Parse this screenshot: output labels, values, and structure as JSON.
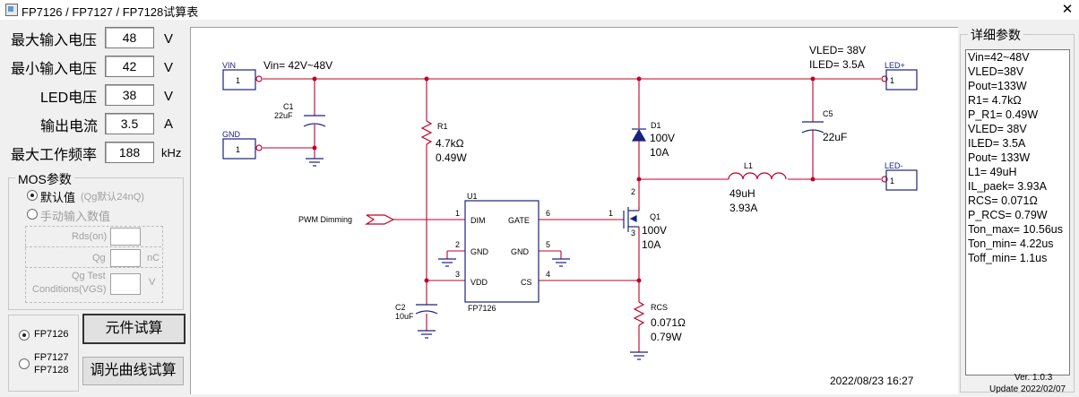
{
  "window": {
    "title": "FP7126 / FP7127 / FP7128试算表",
    "close": "✕"
  },
  "inputs": [
    {
      "label": "最大输入电压",
      "value": "48",
      "unit": "V"
    },
    {
      "label": "最小输入电压",
      "value": "42",
      "unit": "V"
    },
    {
      "label": "LED电压",
      "value": "38",
      "unit": "V"
    },
    {
      "label": "输出电流",
      "value": "3.5",
      "unit": "A"
    },
    {
      "label": "最大工作频率",
      "value": "188",
      "unit": "kHz"
    }
  ],
  "mos": {
    "title": "MOS参数",
    "default_label": "默认值",
    "default_hint": "(Qg默认24nQ)",
    "manual_label": "手动输入数值",
    "rds_label": "Rds(on)",
    "qg_label": "Qg",
    "qg_unit": "nC",
    "qgtest_label_1": "Qg Test",
    "qgtest_label_2": "Conditions(VGS)",
    "qgtest_unit": "V"
  },
  "chip_select": {
    "opt1": "FP7126",
    "opt2a": "FP7127",
    "opt2b": "FP7128"
  },
  "buttons": {
    "calc": "元件试算",
    "dimming": "调光曲线试算"
  },
  "schematic": {
    "vin_port": "VIN",
    "vin_pin": "1",
    "vin_range": "Vin= 42V~48V",
    "gnd_port": "GND",
    "gnd_pin": "1",
    "c1_name": "C1",
    "c1_value": "22uF",
    "r1_name": "R1",
    "r1_value": "4.7kΩ",
    "r1_power": "0.49W",
    "u1_name": "U1",
    "chip": "FP7126",
    "pin_dim": "DIM",
    "pin_gnd": "GND",
    "pin_vdd": "VDD",
    "pin_gate": "GATE",
    "pin_cs": "CS",
    "pin1": "1",
    "pin2": "2",
    "pin3": "3",
    "pin4": "4",
    "pin5": "5",
    "pin6": "6",
    "pwm": "PWM Dimming",
    "c2_name": "C2",
    "c2_value": "10uF",
    "d1_name": "D1",
    "d1_v": "100V",
    "d1_a": "10A",
    "q1_name": "Q1",
    "q1_v": "100V",
    "q1_a": "10A",
    "q1_g": "1",
    "q1_d": "2",
    "q1_s": "3",
    "l1_name": "L1",
    "l1_value": "49uH",
    "l1_current": "3.93A",
    "c5_name": "C5",
    "c5_value": "22uF",
    "vled": "VLED= 38V",
    "iled": "ILED= 3.5A",
    "ledp_port": "LED+",
    "ledp_pin": "1",
    "ledm_port": "LED-",
    "ledm_pin": "1",
    "rcs_name": "RCS",
    "rcs_value": "0.071Ω",
    "rcs_power": "0.79W",
    "date": "2022/08/23 16:27"
  },
  "details": {
    "title": "详细参数",
    "items": [
      "Vin=42~48V",
      "VLED=38V",
      "Pout=133W",
      "R1= 4.7kΩ",
      "P_R1= 0.49W",
      "VLED= 38V",
      "ILED= 3.5A",
      "Pout= 133W",
      "L1= 49uH",
      "IL_paek= 3.93A",
      "RCS= 0.071Ω",
      "P_RCS= 0.79W",
      "Ton_max= 10.56us",
      "Ton_min= 4.22us",
      "Toff_min= 1.1us"
    ]
  },
  "footer": {
    "version": "Ver. 1.0.3",
    "update": "Update 2022/02/07"
  },
  "colors": {
    "wire": "#c0002a",
    "line": "#1a237e",
    "diode": "#1a237e"
  }
}
